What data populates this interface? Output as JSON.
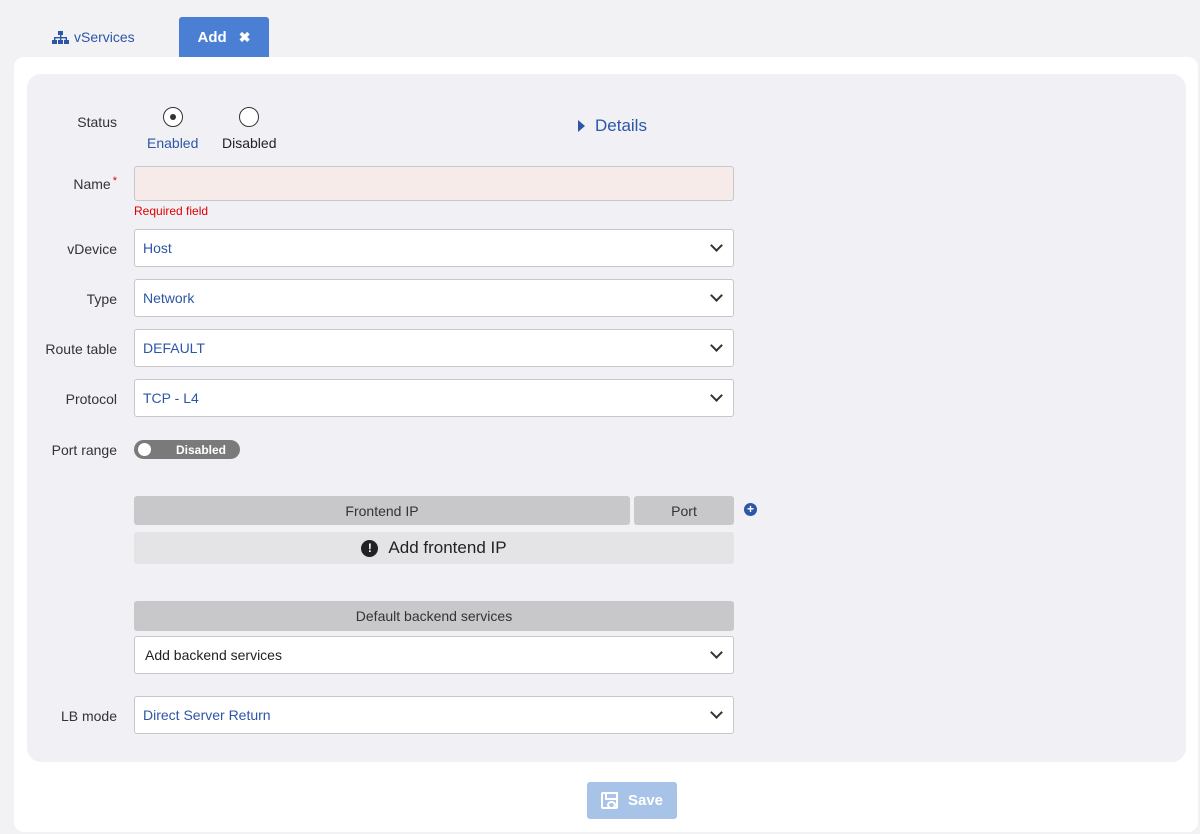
{
  "tabs": {
    "vservices_label": "vServices",
    "add_label": "Add",
    "close_glyph": "✖"
  },
  "form": {
    "status": {
      "label": "Status",
      "options": [
        {
          "label": "Enabled",
          "selected": true
        },
        {
          "label": "Disabled",
          "selected": false
        }
      ]
    },
    "details_link": "Details",
    "name": {
      "label": "Name",
      "required_mark": "*",
      "value": "",
      "error": "Required field"
    },
    "vdevice": {
      "label": "vDevice",
      "value": "Host"
    },
    "type": {
      "label": "Type",
      "value": "Network"
    },
    "route_table": {
      "label": "Route table",
      "value": "DEFAULT"
    },
    "protocol": {
      "label": "Protocol",
      "value": "TCP - L4"
    },
    "port_range": {
      "label": "Port range",
      "toggle_text": "Disabled",
      "enabled": false
    },
    "frontend_table": {
      "col_ip": "Frontend IP",
      "col_port": "Port",
      "empty_text": "Add frontend IP"
    },
    "backend": {
      "header": "Default backend services",
      "placeholder": "Add backend services"
    },
    "lb_mode": {
      "label": "LB mode",
      "value": "Direct Server Return"
    }
  },
  "footer": {
    "save_label": "Save",
    "save_enabled": false
  },
  "colors": {
    "accent": "#4a7fd3",
    "link": "#2d56a6",
    "error": "#dd0000",
    "save_disabled": "#a8c3e8"
  }
}
